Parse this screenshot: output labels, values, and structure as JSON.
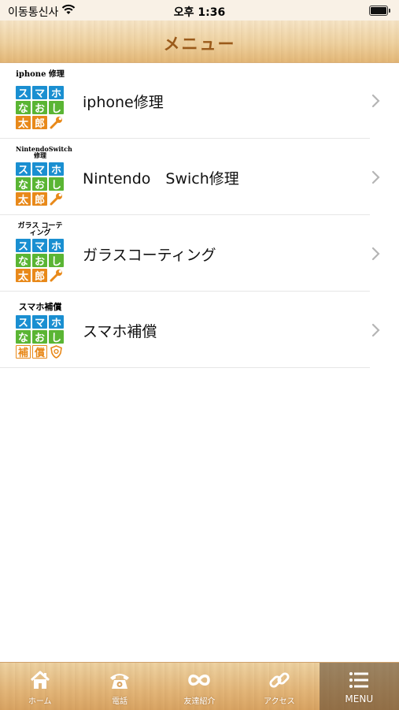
{
  "status_bar": {
    "carrier": "이동통신사",
    "time": "오후 1:36"
  },
  "nav": {
    "title": "メニュー"
  },
  "menu_items": [
    {
      "label": "iphone修理",
      "thumb_caption": "iphone 修理",
      "thumb_rows": [
        [
          "ス",
          "マ",
          "ホ"
        ],
        [
          "な",
          "お",
          "し"
        ],
        [
          "太",
          "郎",
          "wrench"
        ]
      ]
    },
    {
      "label": "Nintendo　Swich修理",
      "thumb_caption": "NintendoSwitch 修理",
      "thumb_rows": [
        [
          "ス",
          "マ",
          "ホ"
        ],
        [
          "な",
          "お",
          "し"
        ],
        [
          "太",
          "郎",
          "wrench"
        ]
      ]
    },
    {
      "label": "ガラスコーティング",
      "thumb_caption": "ガラス コーティング",
      "thumb_rows": [
        [
          "ス",
          "マ",
          "ホ"
        ],
        [
          "な",
          "お",
          "し"
        ],
        [
          "太",
          "郎",
          "wrench"
        ]
      ]
    },
    {
      "label": "スマホ補償",
      "thumb_caption": "スマホ補償",
      "thumb_rows": [
        [
          "ス",
          "マ",
          "ホ"
        ],
        [
          "な",
          "お",
          "し"
        ],
        [
          "補",
          "償",
          "shield"
        ]
      ]
    }
  ],
  "tabs": [
    {
      "label": "ホーム",
      "icon": "home-icon"
    },
    {
      "label": "電話",
      "icon": "phone-icon"
    },
    {
      "label": "友達紹介",
      "icon": "infinity-icon"
    },
    {
      "label": "アクセス",
      "icon": "link-icon"
    },
    {
      "label": "MENU",
      "icon": "menu-list-icon",
      "active": true
    }
  ],
  "colors": {
    "nav_title": "#9a5a1a",
    "tile_blue": "#1a8fd1",
    "tile_green": "#5ab534",
    "tile_orange": "#e8891a"
  }
}
